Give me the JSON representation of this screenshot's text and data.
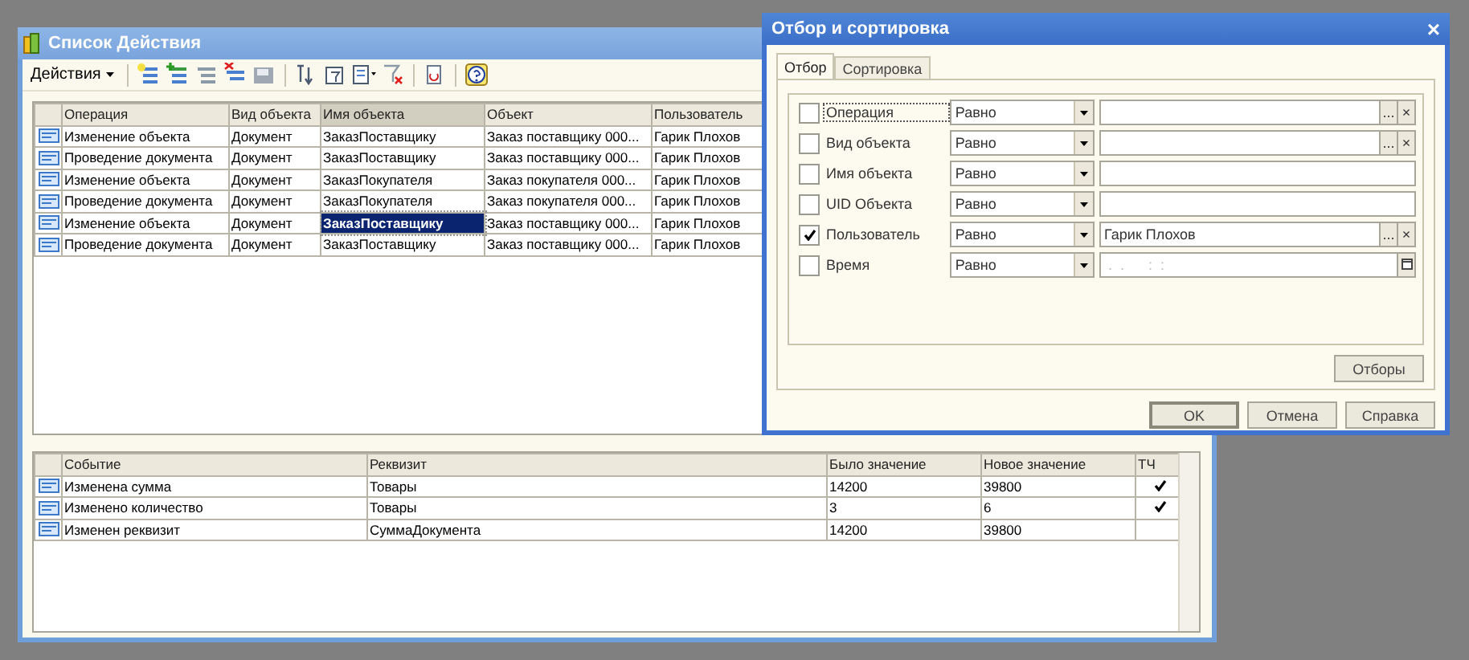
{
  "main_window": {
    "title": "Список Действия",
    "toolbar": {
      "actions_menu": "Действия"
    },
    "events_table": {
      "columns": [
        {
          "label": "Операция",
          "current": false
        },
        {
          "label": "Вид объекта",
          "current": false
        },
        {
          "label": "Имя объекта",
          "current": true
        },
        {
          "label": "Объект",
          "current": false
        },
        {
          "label": "Пользователь",
          "current": false
        }
      ],
      "rows": [
        {
          "cells": [
            "Изменение объекта",
            "Документ",
            "ЗаказПоставщику",
            "Заказ поставщику 000...",
            "Гарик Плохов"
          ],
          "selected": false
        },
        {
          "cells": [
            "Проведение документа",
            "Документ",
            "ЗаказПоставщику",
            "Заказ поставщику 000...",
            "Гарик Плохов"
          ],
          "selected": false
        },
        {
          "cells": [
            "Изменение объекта",
            "Документ",
            "ЗаказПокупателя",
            "Заказ покупателя 000...",
            "Гарик Плохов"
          ],
          "selected": false
        },
        {
          "cells": [
            "Проведение документа",
            "Документ",
            "ЗаказПокупателя",
            "Заказ покупателя 000...",
            "Гарик Плохов"
          ],
          "selected": false
        },
        {
          "cells": [
            "Изменение объекта",
            "Документ",
            "ЗаказПоставщику",
            "Заказ поставщику 000...",
            "Гарик Плохов"
          ],
          "selected": true
        },
        {
          "cells": [
            "Проведение документа",
            "Документ",
            "ЗаказПоставщику",
            "Заказ поставщику 000...",
            "Гарик Плохов"
          ],
          "selected": false
        }
      ]
    },
    "changes_table": {
      "columns": [
        "Событие",
        "Реквизит",
        "Было значение",
        "Новое значение",
        "ТЧ"
      ],
      "rows": [
        {
          "cells": [
            "Изменена сумма",
            "Товары",
            "14200",
            "39800"
          ],
          "tc": true
        },
        {
          "cells": [
            "Изменено количество",
            "Товары",
            "3",
            "6"
          ],
          "tc": true
        },
        {
          "cells": [
            "Изменен реквизит",
            "СуммаДокумента",
            "14200",
            "39800"
          ],
          "tc": false
        }
      ]
    }
  },
  "filter_dialog": {
    "title": "Отбор и сортировка",
    "close": "×",
    "tabs": [
      {
        "label": "Отбор",
        "selected": true
      },
      {
        "label": "Сортировка",
        "selected": false
      }
    ],
    "filters": [
      {
        "label": "Операция",
        "checked": false,
        "focused": true,
        "condition": "Равно",
        "kind": "pick",
        "buttons": [
          "...",
          "×"
        ]
      },
      {
        "label": "Вид объекта",
        "checked": false,
        "focused": false,
        "condition": "Равно",
        "kind": "pick",
        "buttons": [
          "...",
          "×"
        ]
      },
      {
        "label": "Имя объекта",
        "checked": false,
        "focused": false,
        "condition": "Равно",
        "kind": "plain"
      },
      {
        "label": "UID Объекта",
        "checked": false,
        "focused": false,
        "condition": "Равно",
        "kind": "plain"
      },
      {
        "label": "Пользователь",
        "checked": true,
        "focused": false,
        "condition": "Равно",
        "kind": "pick",
        "value": "Гарик Плохов",
        "buttons": [
          "...",
          "×"
        ]
      },
      {
        "label": "Время",
        "checked": false,
        "focused": false,
        "condition": "Равно",
        "kind": "date",
        "placeholder": " .  .      :  :"
      }
    ],
    "filters_button": "Отборы",
    "buttons": [
      "OK",
      "Отмена",
      "Справка"
    ]
  }
}
